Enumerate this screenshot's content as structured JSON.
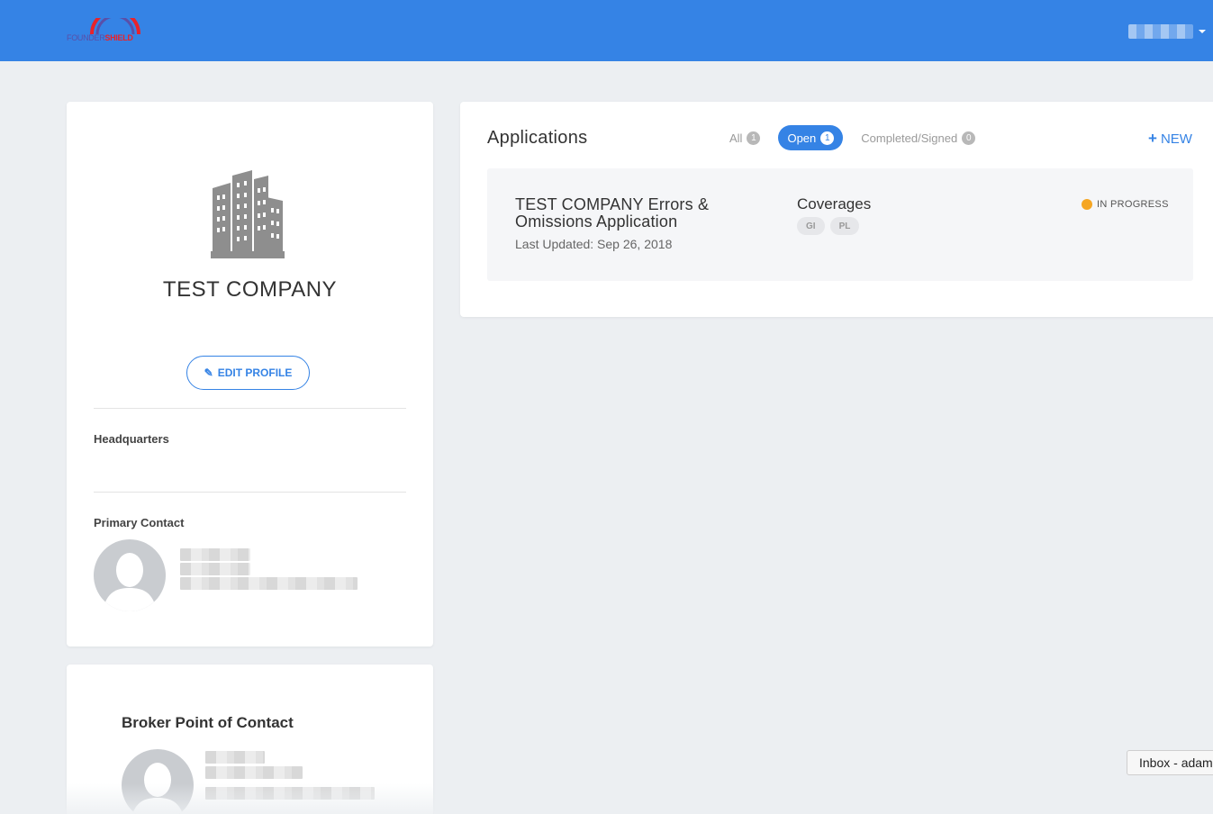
{
  "header": {
    "brand_part1": "FOUNDER",
    "brand_part2": "SHIELD",
    "brand_color": "#3583e5"
  },
  "profile": {
    "company_name": "TEST COMPANY",
    "edit_label": "EDIT PROFILE",
    "edit_icon": "pencil-square-icon",
    "headquarters_label": "Headquarters",
    "primary_contact_label": "Primary Contact"
  },
  "broker": {
    "title": "Broker Point of Contact"
  },
  "applications": {
    "title": "Applications",
    "filters": [
      {
        "label": "All",
        "count": "1"
      },
      {
        "label": "Open",
        "count": "1"
      },
      {
        "label": "Completed/Signed",
        "count": "0"
      }
    ],
    "new_label": "NEW",
    "items": [
      {
        "name": "TEST COMPANY Errors & Omissions Application",
        "last_updated": "Last Updated: Sep 26, 2018",
        "coverages_label": "Coverages",
        "tags": [
          "GI",
          "PL"
        ],
        "status": "IN PROGRESS",
        "status_color": "#f5a623"
      }
    ]
  },
  "tooltip": {
    "text": "Inbox - adam"
  }
}
